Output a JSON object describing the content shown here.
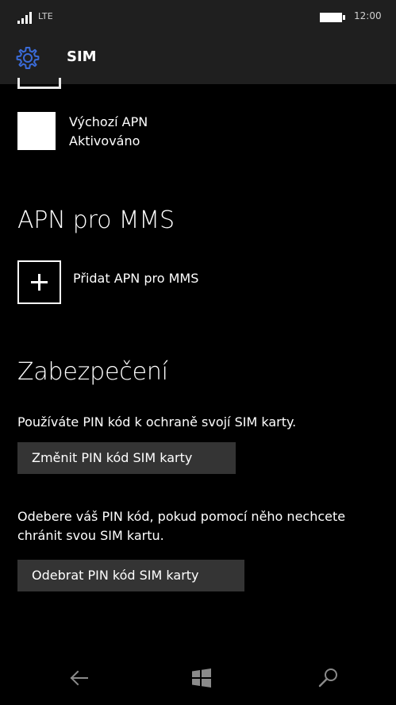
{
  "status_bar": {
    "network": "LTE",
    "time": "12:00"
  },
  "header": {
    "title": "SIM",
    "icon": "gear-icon"
  },
  "apn_list": {
    "default_apn": {
      "title": "Výchozí APN",
      "status": "Aktivováno"
    }
  },
  "mms_section": {
    "title": "APN pro MMS",
    "add_label": "Přidat APN pro MMS"
  },
  "security_section": {
    "title": "Zabezpečení",
    "pin_description": "Používáte PIN kód k ochraně svojí SIM karty.",
    "change_button": "Změnit PIN kód SIM karty",
    "remove_description": "Odebere váš PIN kód, pokud pomocí něho nechcete chránit svou SIM kartu.",
    "remove_button": "Odebrat PIN kód SIM karty"
  },
  "navigation": {
    "back_icon": "back-arrow-icon",
    "home_icon": "windows-icon",
    "search_icon": "search-icon"
  },
  "colors": {
    "background": "#000000",
    "header_background": "#1f1f1f",
    "accent": "#3a6bd8",
    "button_background": "#343434",
    "text": "#ffffff"
  }
}
